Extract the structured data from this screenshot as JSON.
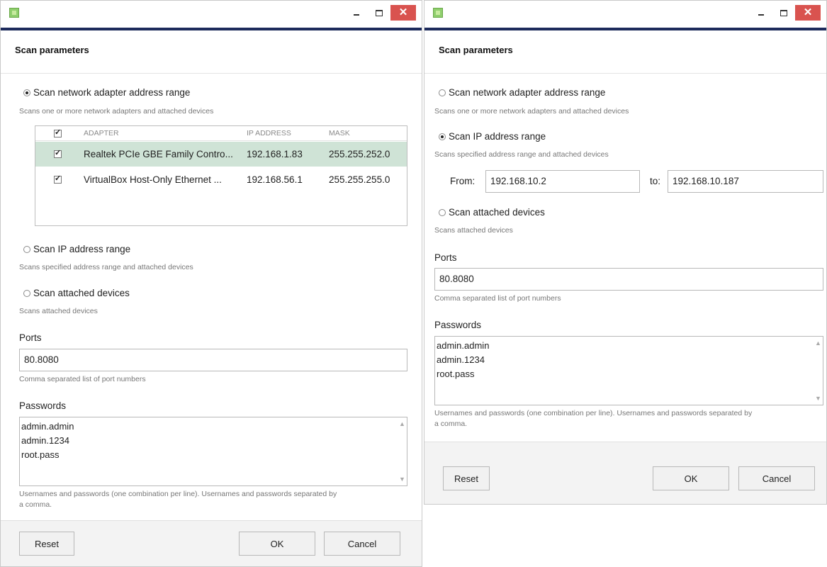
{
  "left": {
    "section_title": "Scan parameters",
    "options": [
      {
        "label": "Scan network adapter address range",
        "hint": "Scans one or more network adapters and attached devices",
        "selected": true
      },
      {
        "label": "Scan IP address range",
        "hint": "Scans specified address range and attached devices",
        "selected": false
      },
      {
        "label": "Scan attached devices",
        "hint": "Scans attached devices",
        "selected": false
      }
    ],
    "adapter_table": {
      "columns": [
        "ADAPTER",
        "IP ADDRESS",
        "MASK"
      ],
      "rows": [
        {
          "checked": true,
          "adapter": "Realtek PCIe GBE Family Contro...",
          "ip": "192.168.1.83",
          "mask": "255.255.252.0",
          "selected": true
        },
        {
          "checked": true,
          "adapter": "VirtualBox Host-Only Ethernet ...",
          "ip": "192.168.56.1",
          "mask": "255.255.255.0",
          "selected": false
        }
      ]
    },
    "ports": {
      "label": "Ports",
      "value": "80.8080",
      "hint": "Comma separated list of port numbers"
    },
    "passwords": {
      "label": "Passwords",
      "lines": [
        "admin.admin",
        "admin.1234",
        "root.pass"
      ],
      "hint_line1": "Usernames and passwords (one combination per line). Usernames and passwords separated by",
      "hint_line2": "a comma."
    },
    "buttons": {
      "reset": "Reset",
      "ok": "OK",
      "cancel": "Cancel"
    }
  },
  "right": {
    "section_title": "Scan parameters",
    "options": [
      {
        "label": "Scan network adapter address range",
        "hint": "Scans one or more network adapters and attached devices",
        "selected": false
      },
      {
        "label": "Scan IP address range",
        "hint": "Scans specified address range and attached devices",
        "selected": true
      },
      {
        "label": "Scan attached devices",
        "hint": "Scans attached devices",
        "selected": false
      }
    ],
    "range": {
      "from_label": "From:",
      "from_value": "192.168.10.2",
      "to_label": "to:",
      "to_value": "192.168.10.187"
    },
    "ports": {
      "label": "Ports",
      "value": "80.8080",
      "hint": "Comma separated list of port numbers"
    },
    "passwords": {
      "label": "Passwords",
      "lines": [
        "admin.admin",
        "admin.1234",
        "root.pass"
      ],
      "hint_line1": "Usernames and passwords (one combination per line). Usernames and passwords separated by",
      "hint_line2": "a comma."
    },
    "buttons": {
      "reset": "Reset",
      "ok": "OK",
      "cancel": "Cancel"
    }
  },
  "icons": {
    "app": "app-icon",
    "minimize": "minimize-icon",
    "maximize": "maximize-icon",
    "close": "close-icon",
    "close_glyph": "✕"
  },
  "colors": {
    "titlebar_accent": "#1d2b5c",
    "close_button": "#d9534f",
    "selected_row": "#cfe3d6"
  }
}
